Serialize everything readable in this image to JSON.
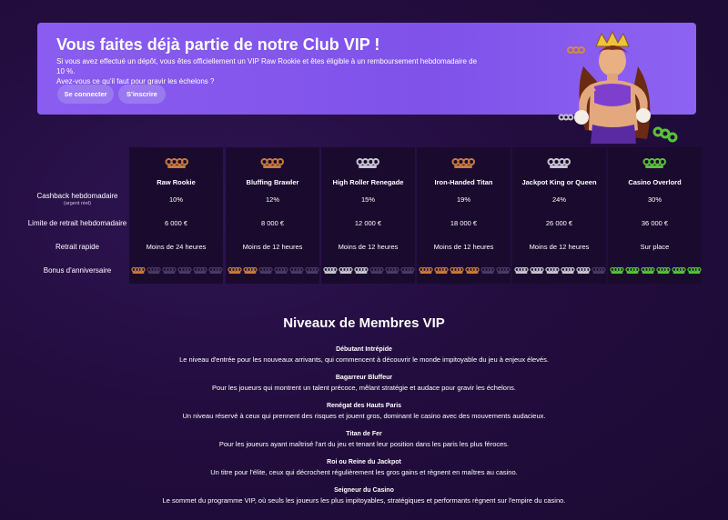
{
  "banner": {
    "title": "Vous faites déjà partie de notre Club VIP !",
    "subtitle_1": "Si vous avez effectué un dépôt, vous êtes officiellement un VIP Raw Rookie et êtes éligible à un remboursement hebdomadaire de 10 %.",
    "subtitle_2": "Avez-vous ce qu'il faut pour gravir les échelons ?",
    "login_label": "Se connecter",
    "signup_label": "S'inscrire"
  },
  "colors": {
    "banner": "#8a5cf0",
    "background": "#230d3f",
    "bronze": "#c87a3c",
    "silver": "#c6c6d0",
    "green": "#58c23a"
  },
  "table": {
    "rows": [
      {
        "label": "Cashback hebdomadaire",
        "sub": "(argent réel)"
      },
      {
        "label": "Limite de retrait hebdomadaire"
      },
      {
        "label": "Retrait rapide"
      },
      {
        "label": "Bonus d'anniversaire"
      }
    ],
    "tiers": [
      {
        "name": "Raw Rookie",
        "icon": "brass-knuckles-bronze-icon",
        "cashback": "10%",
        "limit": "6 000 €",
        "withdrawal": "Moins de 24 heures",
        "bonus_filled": 1
      },
      {
        "name": "Bluffing Brawler",
        "icon": "brass-knuckles-bronze-icon",
        "cashback": "12%",
        "limit": "8 000 €",
        "withdrawal": "Moins de 12 heures",
        "bonus_filled": 2
      },
      {
        "name": "High Roller Renegade",
        "icon": "brass-knuckles-silver-icon",
        "cashback": "15%",
        "limit": "12 000 €",
        "withdrawal": "Moins de 12 heures",
        "bonus_filled": 3
      },
      {
        "name": "Iron-Handed Titan",
        "icon": "brass-knuckles-bronze-icon",
        "cashback": "19%",
        "limit": "18 000 €",
        "withdrawal": "Moins de 12 heures",
        "bonus_filled": 4
      },
      {
        "name": "Jackpot King or Queen",
        "icon": "brass-knuckles-silver-icon",
        "cashback": "24%",
        "limit": "26 000 €",
        "withdrawal": "Moins de 12 heures",
        "bonus_filled": 5
      },
      {
        "name": "Casino Overlord",
        "icon": "brass-knuckles-green-icon",
        "cashback": "30%",
        "limit": "36 000 €",
        "withdrawal": "Sur place",
        "bonus_filled": 6
      }
    ]
  },
  "levels": {
    "title": "Niveaux de Membres VIP",
    "items": [
      {
        "name": "Débutant Intrépide",
        "desc": "Le niveau d'entrée pour les nouveaux arrivants, qui commencent à découvrir le monde impitoyable du jeu à enjeux élevés."
      },
      {
        "name": "Bagarreur Bluffeur",
        "desc": "Pour les joueurs qui montrent un talent précoce, mêlant stratégie et audace pour gravir les échelons."
      },
      {
        "name": "Renégat des Hauts Paris",
        "desc": "Un niveau réservé à ceux qui prennent des risques et jouent gros, dominant le casino avec des mouvements audacieux."
      },
      {
        "name": "Titan de Fer",
        "desc": "Pour les joueurs ayant maîtrisé l'art du jeu et tenant leur position dans les paris les plus féroces."
      },
      {
        "name": "Roi ou Reine du Jackpot",
        "desc": "Un titre pour l'élite, ceux qui décrochent régulièrement les gros gains et règnent en maîtres au casino."
      },
      {
        "name": "Seigneur du Casino",
        "desc": "Le sommet du programme VIP, où seuls les joueurs les plus impitoyables, stratégiques et performants règnent sur l'empire du casino."
      }
    ]
  }
}
